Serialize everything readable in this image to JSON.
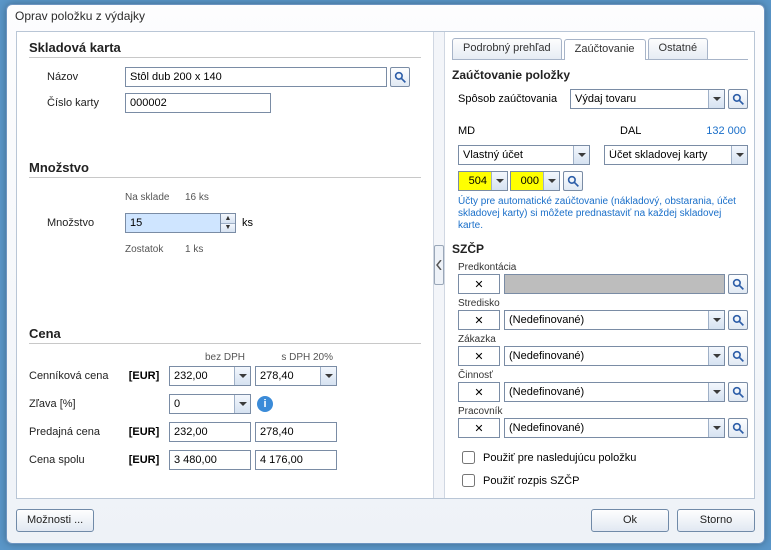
{
  "title": "Oprav položku z výdajky",
  "left": {
    "skladova": {
      "title": "Skladová karta",
      "nazov_lbl": "Názov",
      "nazov_val": "Stôl dub 200 x 140",
      "cislo_lbl": "Číslo karty",
      "cislo_val": "000002"
    },
    "mnozstvo": {
      "title": "Množstvo",
      "nasklade_lbl": "Na sklade",
      "nasklade_val": "16 ks",
      "mnozstvo_lbl": "Množstvo",
      "mnozstvo_val": "15",
      "unit": "ks",
      "zostatok_lbl": "Zostatok",
      "zostatok_val": "1 ks"
    },
    "cena": {
      "title": "Cena",
      "hdr_bez": "bez DPH",
      "hdr_s": "s DPH 20%",
      "cennik_lbl": "Cenníková cena",
      "cennik_cur": "[EUR]",
      "cennik_bez": "232,00",
      "cennik_s": "278,40",
      "zlava_lbl": "Zľava [%]",
      "zlava_val": "0",
      "predaj_lbl": "Predajná cena",
      "predaj_cur": "[EUR]",
      "predaj_bez": "232,00",
      "predaj_s": "278,40",
      "spolu_lbl": "Cena spolu",
      "spolu_cur": "[EUR]",
      "spolu_bez": "3 480,00",
      "spolu_s": "4 176,00"
    }
  },
  "right": {
    "tabs": {
      "t1": "Podrobný prehľad",
      "t2": "Zaúčtovanie",
      "t3": "Ostatné"
    },
    "zauc": {
      "title": "Zaúčtovanie položky",
      "sposob_lbl": "Spôsob zaúčtovania",
      "sposob_val": "Výdaj tovaru",
      "md_lbl": "MD",
      "md_combo": "Vlastný účet",
      "md_v1": "504",
      "md_v2": "000",
      "dal_lbl": "DAL",
      "dal_num": "132 000",
      "dal_combo": "Účet skladovej karty",
      "hint": "Účty pre automatické zaúčtovanie (nákladový, obstarania, účet skladovej karty) si môžete prednastaviť na každej skladovej karte."
    },
    "szcp": {
      "title": "SZČP",
      "predk": "Predkontácia",
      "stred": "Stredisko",
      "zak": "Zákazka",
      "cin": "Činnosť",
      "prac": "Pracovník",
      "x": "✕",
      "nedef": "(Nedefinované)",
      "chk1": "Použiť pre nasledujúcu položku",
      "chk2": "Použiť rozpis SZČP"
    }
  },
  "buttons": {
    "moznosti": "Možnosti ...",
    "ok": "Ok",
    "storno": "Storno"
  }
}
